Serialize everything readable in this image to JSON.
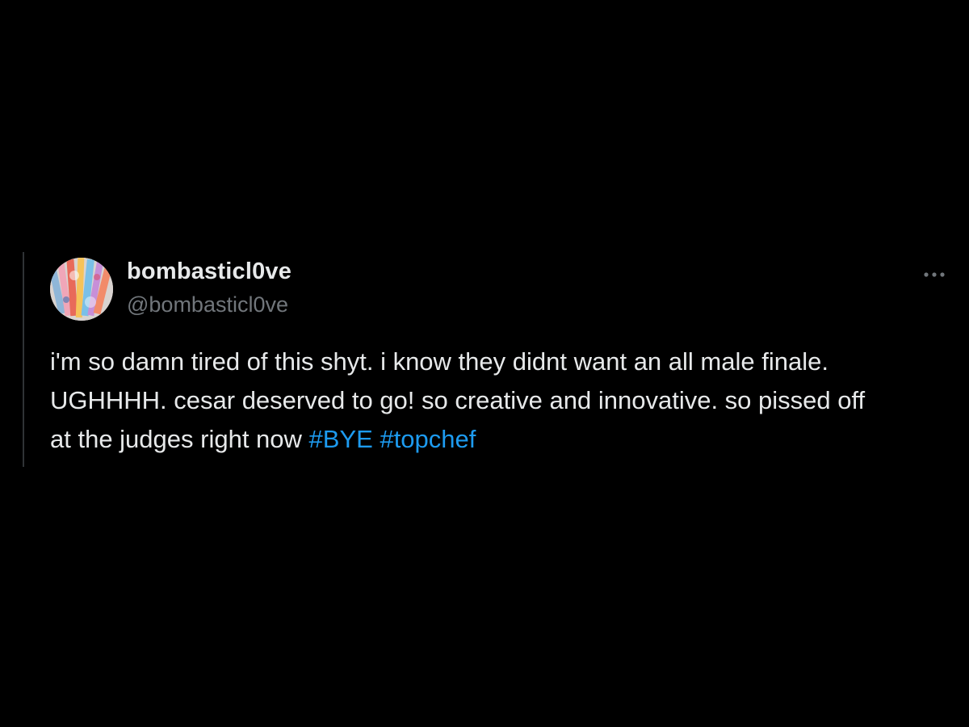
{
  "tweet": {
    "display_name": "bombasticl0ve",
    "handle": "@bombasticl0ve",
    "more_icon": "more-horizontal-icon",
    "text_lines": [
      "i'm so damn tired of this shyt. i know they didnt want an all male finale.",
      "UGHHHH. cesar deserved to go! so creative and innovative. so pissed off",
      "at the judges right now "
    ],
    "hashtags": [
      "#BYE",
      "#topchef"
    ]
  },
  "colors": {
    "background": "#000000",
    "text_primary": "#e7e9ea",
    "text_secondary": "#71767b",
    "link": "#1d9bf0",
    "quote_bar": "#2f3336"
  }
}
